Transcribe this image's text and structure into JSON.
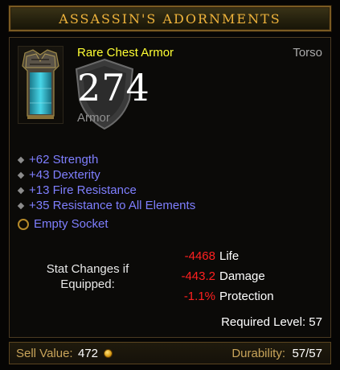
{
  "item": {
    "name": "Assassin's Adornments",
    "type": "Rare Chest Armor",
    "slot": "Torso",
    "armor_value": "274",
    "armor_label": "Armor"
  },
  "affixes": [
    "+62 Strength",
    "+43 Dexterity",
    "+13 Fire Resistance",
    "+35 Resistance to All Elements"
  ],
  "socket": {
    "label": "Empty Socket"
  },
  "stat_changes": {
    "heading_line1": "Stat Changes if",
    "heading_line2": "Equipped:",
    "rows": [
      {
        "value": "-4468",
        "label": "Life"
      },
      {
        "value": "-443.2",
        "label": "Damage"
      },
      {
        "value": "-1.1%",
        "label": "Protection"
      }
    ]
  },
  "required_level": "Required Level: 57",
  "footer": {
    "sell_label": "Sell Value:",
    "sell_value": "472",
    "durability_label": "Durability:",
    "durability_value": "57/57"
  },
  "colors": {
    "title": "#f0b43c",
    "rare": "#ffff33",
    "magic_affix": "#7f7fff",
    "negative": "#ff2020",
    "footer_label": "#c8a45a"
  },
  "icons": {
    "item": "chest-armor-icon",
    "background": "shield-icon",
    "socket": "socket-icon",
    "currency": "gold-coin-icon"
  }
}
